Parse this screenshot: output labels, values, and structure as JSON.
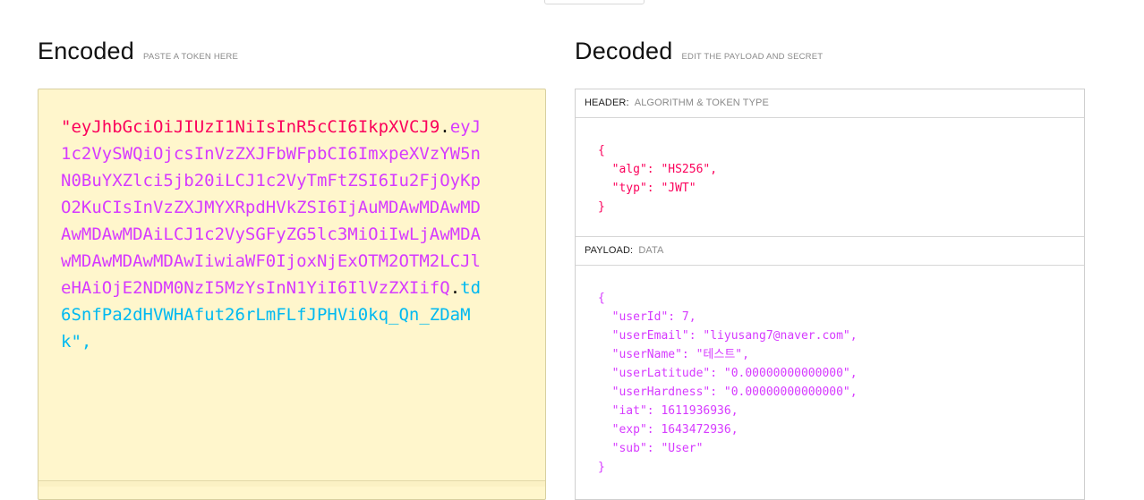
{
  "encoded": {
    "title": "Encoded",
    "subtitle": "PASTE A TOKEN HERE",
    "token_open_quote": "\"",
    "token_header": "eyJhbGciOiJIUzI1NiIsInR5cCI6IkpXVCJ9",
    "token_dot1": ".",
    "token_payload": "eyJ1c2VySWQiOjcsInVzZXJFbWFpbCI6ImxpeXVzYW5nN0BuYXZlci5jb20iLCJ1c2VyTmFtZSI6Iu2FjOyKpO2KuCIsInVzZXJMYXRpdHVkZSI6IjAuMDAwMDAwMDAwMDAwMDAiLCJ1c2VySGFyZG5lc3MiOiIwLjAwMDAwMDAwMDAwMDAwIiwiaWF0IjoxNjExOTM2OTM2LCJleHAiOjE2NDM0NzI5MzYsInN1YiI6IlVzZXIifQ",
    "token_dot2": ".",
    "token_signature": "td6SnfPa2dHVWHAfut26rLmFLfJPHVi0kq_Qn_ZDaMk",
    "token_close": "\","
  },
  "decoded": {
    "title": "Decoded",
    "subtitle": "EDIT THE PAYLOAD AND SECRET",
    "header_label": "HEADER:",
    "header_label_sub": "ALGORITHM & TOKEN TYPE",
    "header_json": "{\n  \"alg\": \"HS256\",\n  \"typ\": \"JWT\"\n}",
    "payload_label": "PAYLOAD:",
    "payload_label_sub": "DATA",
    "payload_json": "{\n  \"userId\": 7,\n  \"userEmail\": \"liyusang7@naver.com\",\n  \"userName\": \"테스트\",\n  \"userLatitude\": \"0.00000000000000\",\n  \"userHardness\": \"0.00000000000000\",\n  \"iat\": 1611936936,\n  \"exp\": 1643472936,\n  \"sub\": \"User\"\n}"
  },
  "colors": {
    "header": "#fb015b",
    "payload": "#d63aff",
    "signature": "#00b9f1",
    "encoded_bg": "#fff6cc"
  }
}
